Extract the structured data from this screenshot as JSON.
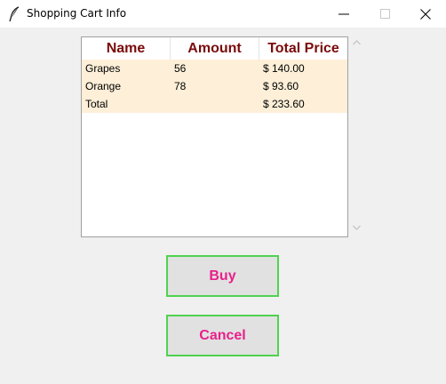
{
  "window": {
    "title": "Shopping Cart Info"
  },
  "table": {
    "columns": [
      "Name",
      "Amount",
      "Total Price"
    ],
    "rows": [
      {
        "name": "Grapes",
        "amount": "56",
        "total": "$ 140.00"
      },
      {
        "name": "Orange",
        "amount": "78",
        "total": "$ 93.60"
      },
      {
        "name": "Total",
        "amount": "",
        "total": "$ 233.60"
      }
    ]
  },
  "buttons": {
    "buy": "Buy",
    "cancel": "Cancel"
  },
  "colors": {
    "header_text": "#7a0a0a",
    "row_background": "#fdefd8",
    "button_text": "#e8208a",
    "button_border": "#4fd34f"
  },
  "icons": [
    "feather-icon",
    "minimize-icon",
    "maximize-icon",
    "close-icon",
    "scroll-up-icon",
    "scroll-down-icon"
  ]
}
